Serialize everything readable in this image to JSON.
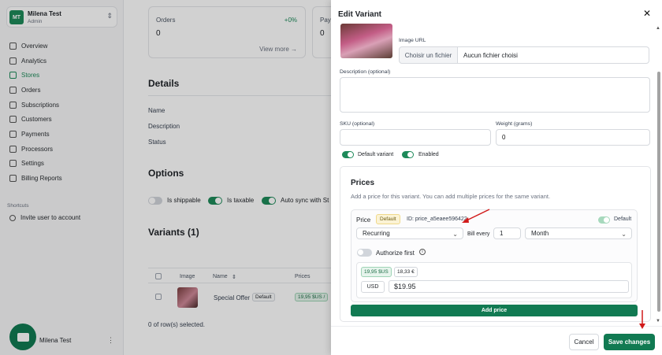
{
  "sidebar": {
    "account": {
      "initials": "MT",
      "name": "Milena Test",
      "role": "Admin"
    },
    "items": [
      {
        "label": "Overview"
      },
      {
        "label": "Analytics"
      },
      {
        "label": "Stores"
      },
      {
        "label": "Orders"
      },
      {
        "label": "Subscriptions"
      },
      {
        "label": "Customers"
      },
      {
        "label": "Payments"
      },
      {
        "label": "Processors"
      },
      {
        "label": "Settings"
      },
      {
        "label": "Billing Reports"
      }
    ],
    "active_item": "Stores",
    "shortcuts_label": "Shortcuts",
    "shortcut_item": "Invite user to account",
    "bottom_user": "Milena Test",
    "bottom_menu": "⋮"
  },
  "main": {
    "cards": [
      {
        "label": "Orders",
        "value": "0",
        "change": "+0%",
        "link": "View more →"
      },
      {
        "label": "Pay",
        "value": "0"
      }
    ],
    "details": {
      "title": "Details",
      "rows": [
        "Name",
        "Description",
        "Status"
      ]
    },
    "options": {
      "title": "Options",
      "items": [
        {
          "label": "Is shippable",
          "on": false
        },
        {
          "label": "Is taxable",
          "on": true
        },
        {
          "label": "Auto sync with St",
          "on": true
        }
      ]
    },
    "variants": {
      "title": "Variants (1)",
      "columns": [
        "Image",
        "Name",
        "Prices"
      ],
      "sort_icon": "⇕",
      "rows": [
        {
          "name": "Special Offer",
          "badge": "Default",
          "price": "19,95 $US /"
        }
      ],
      "footer": "0 of row(s) selected."
    }
  },
  "modal": {
    "title": "Edit Variant",
    "close_glyph": "✕",
    "image_url_label": "Image URL",
    "file_button": "Choisir un fichier",
    "file_name": "Aucun fichier choisi",
    "description_label": "Description (optional)",
    "sku_label": "SKU (optional)",
    "weight_label": "Weight (grams)",
    "weight_value": "0",
    "toggles": [
      {
        "label": "Default variant",
        "on": true
      },
      {
        "label": "Enabled",
        "on": true
      }
    ],
    "prices": {
      "title": "Prices",
      "subtitle": "Add a price for this variant. You can add multiple prices for the same variant.",
      "price_label": "Price",
      "default_tag": "Default",
      "price_id": "ID: price_a5eaee596422",
      "default_toggle_label": "Default",
      "billing_type": "Recurring",
      "bill_every_label": "Bill every",
      "interval_count": "1",
      "interval": "Month",
      "authorize_label": "Authorize first",
      "info_glyph": "i",
      "chips": [
        "19,95 $US",
        "18,33 €"
      ],
      "currency": "USD",
      "amount": "$19.95",
      "add_price": "Add price"
    },
    "cancel": "Cancel",
    "save": "Save changes"
  },
  "colors": {
    "accent": "#117a52",
    "annotation_arrow": "#d11a1a"
  }
}
